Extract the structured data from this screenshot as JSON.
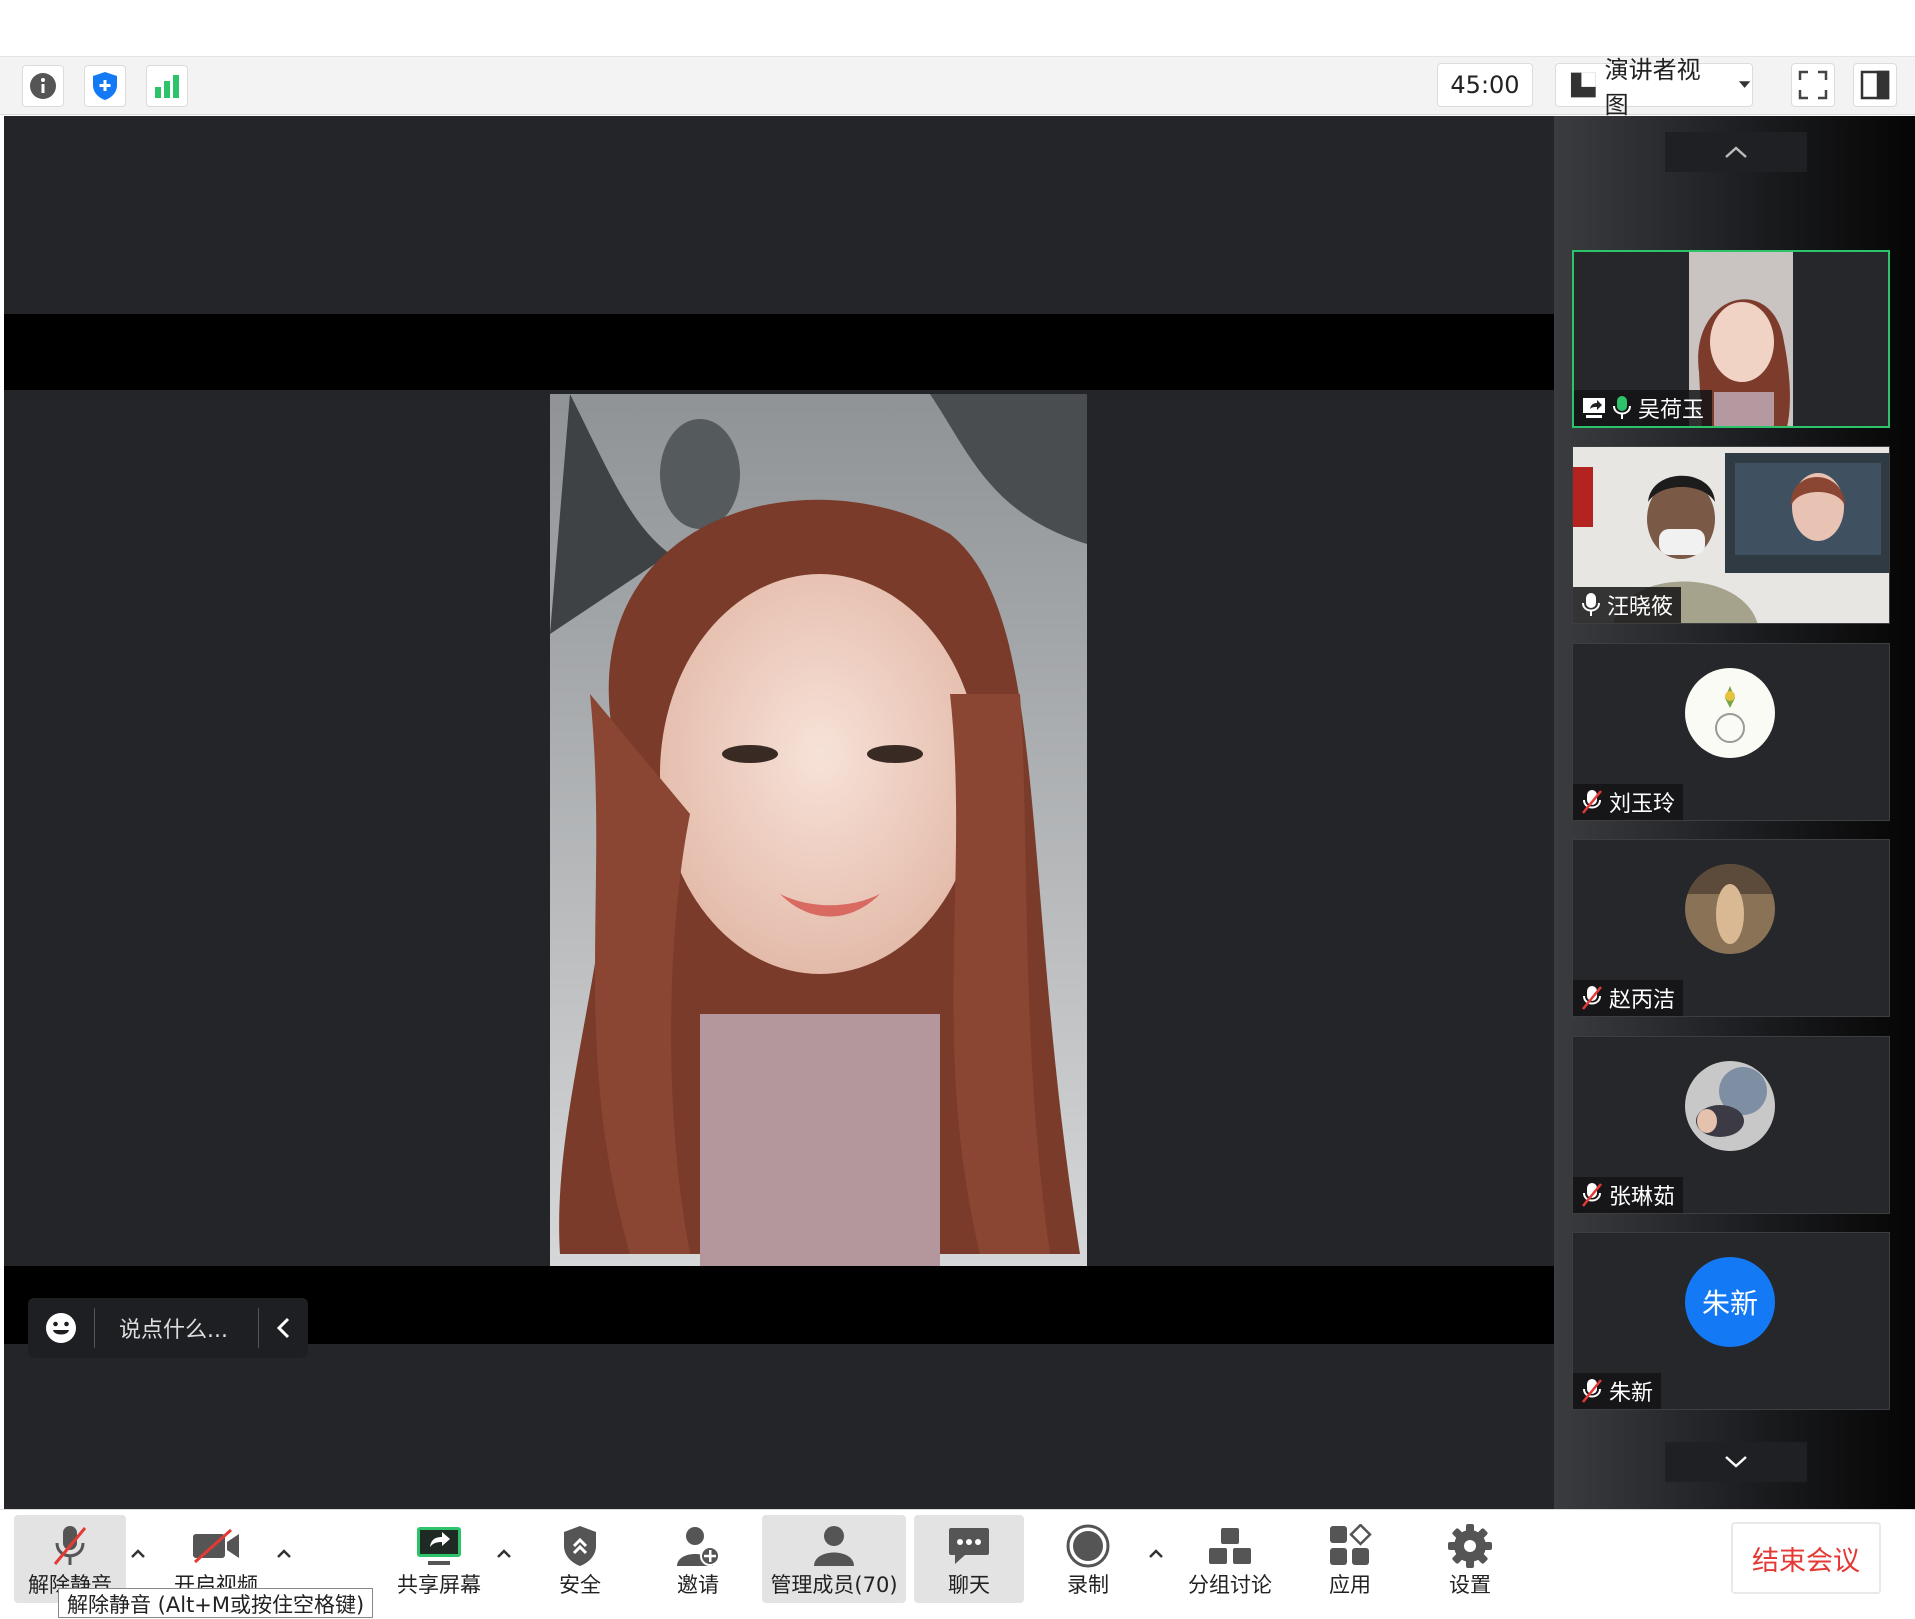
{
  "toolbar": {
    "timer": "45:00",
    "view_mode": "演讲者视图"
  },
  "chat": {
    "placeholder": "说点什么..."
  },
  "participants": [
    {
      "name": "吴荷玉",
      "mic": "on",
      "sharing": true,
      "active": true
    },
    {
      "name": "汪晓筱",
      "mic": "on"
    },
    {
      "name": "刘玉玲",
      "mic": "muted"
    },
    {
      "name": "赵丙洁",
      "mic": "muted"
    },
    {
      "name": "张琳茹",
      "mic": "muted"
    },
    {
      "name": "朱新",
      "mic": "muted",
      "avatar_text": "朱新",
      "avatar_color": "#1479f5"
    }
  ],
  "bottombar": {
    "unmute": "解除静音",
    "unmute_tooltip": "解除静音 (Alt+M或按住空格键)",
    "video": "开启视频",
    "share": "共享屏幕",
    "security": "安全",
    "invite": "邀请",
    "members": "管理成员(70)",
    "chat": "聊天",
    "record": "录制",
    "breakout": "分组讨论",
    "apps": "应用",
    "settings": "设置",
    "end": "结束会议"
  },
  "colors": {
    "accent_green": "#2cc36b",
    "end_red": "#e53935",
    "shield_blue": "#1479f5"
  }
}
